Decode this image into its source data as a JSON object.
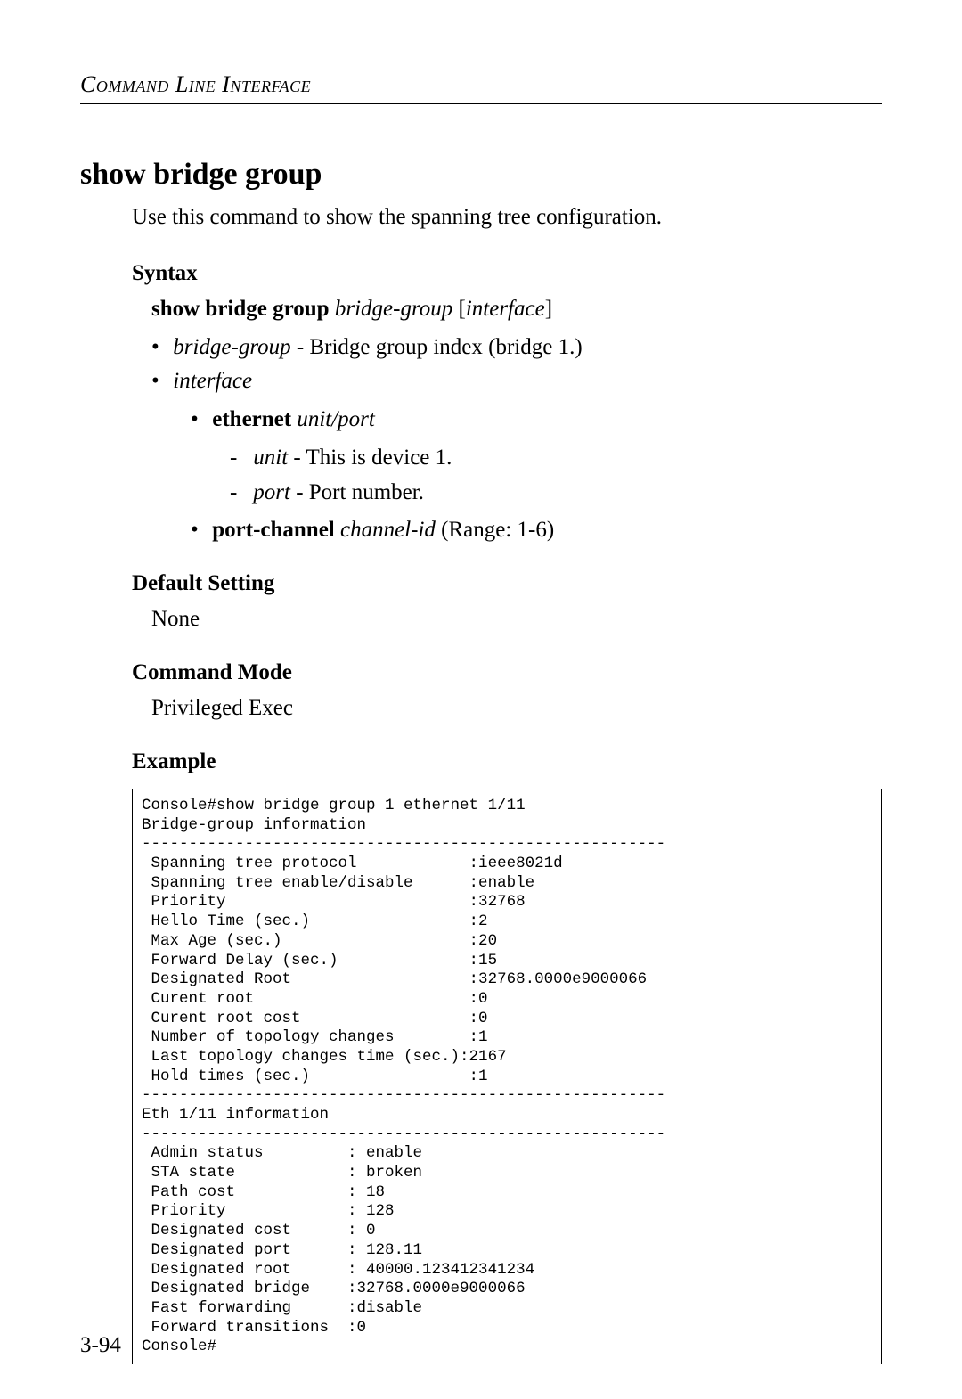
{
  "running_head": "Command Line Interface",
  "title": "show bridge group",
  "intro": "Use this command to show the spanning tree configuration.",
  "syntax": {
    "heading": "Syntax",
    "line_cmd": "show bridge group",
    "line_arg1": "bridge-group",
    "line_arg2_open": "[",
    "line_arg2": "interface",
    "line_arg2_close": "]",
    "bridge_group_name": "bridge-group",
    "bridge_group_desc": " - Bridge group index (bridge 1.)",
    "interface_name": "interface",
    "ethernet_cmd": "ethernet",
    "ethernet_arg": "unit/port",
    "unit_name": "unit",
    "unit_desc": " - This is device 1.",
    "port_name": "port",
    "port_desc": " - Port number.",
    "portchannel_cmd": "port-channel",
    "portchannel_arg": "channel-id",
    "portchannel_tail": " (Range: 1-6)"
  },
  "default_setting": {
    "heading": "Default Setting",
    "value": "None"
  },
  "command_mode": {
    "heading": "Command Mode",
    "value": "Privileged Exec"
  },
  "example": {
    "heading": "Example",
    "console": "Console#show bridge group 1 ethernet 1/11\nBridge-group information\n--------------------------------------------------------\n Spanning tree protocol            :ieee8021d\n Spanning tree enable/disable      :enable\n Priority                          :32768\n Hello Time (sec.)                 :2\n Max Age (sec.)                    :20\n Forward Delay (sec.)              :15\n Designated Root                   :32768.0000e9000066\n Curent root                       :0\n Curent root cost                  :0\n Number of topology changes        :1\n Last topology changes time (sec.):2167\n Hold times (sec.)                 :1\n--------------------------------------------------------\nEth 1/11 information\n--------------------------------------------------------\n Admin status         : enable\n STA state            : broken\n Path cost            : 18\n Priority             : 128\n Designated cost      : 0\n Designated port      : 128.11\n Designated root      : 40000.123412341234\n Designated bridge    :32768.0000e9000066\n Fast forwarding      :disable\n Forward transitions  :0\nConsole#"
  },
  "page_number": "3-94"
}
